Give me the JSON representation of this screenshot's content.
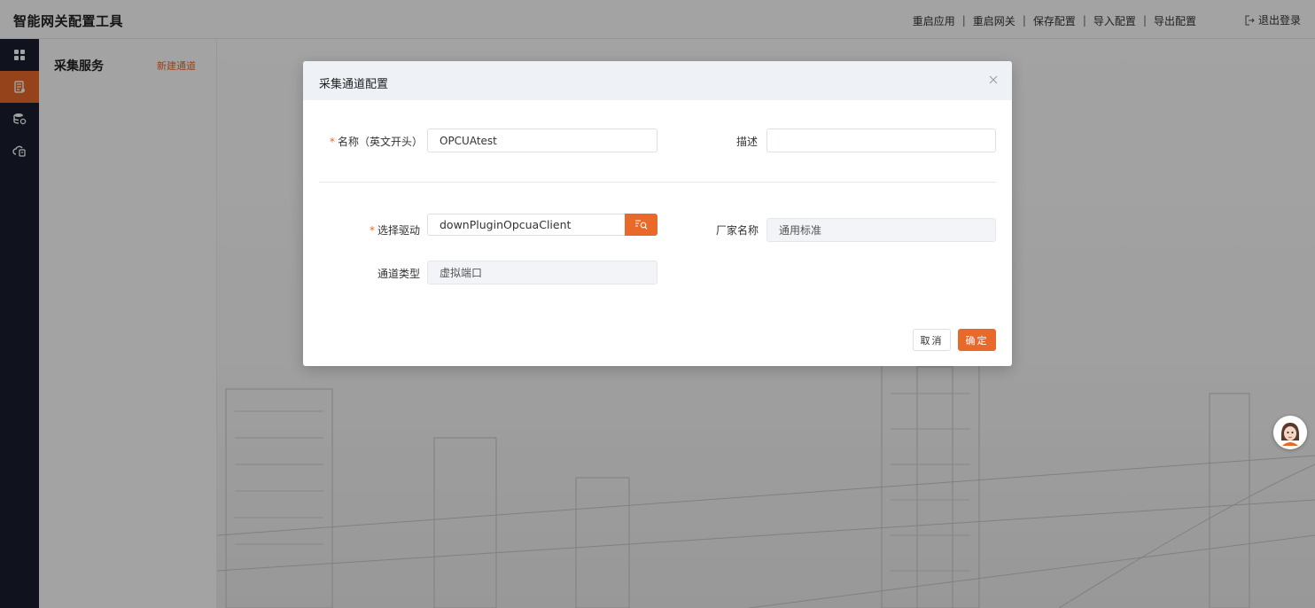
{
  "header": {
    "app_title": "智能网关配置工具",
    "nav": [
      {
        "label": "重启应用"
      },
      {
        "label": "重启网关"
      },
      {
        "label": "保存配置"
      },
      {
        "label": "导入配置"
      },
      {
        "label": "导出配置"
      }
    ],
    "separator": "|",
    "logout_label": "退出登录"
  },
  "rail": {
    "items": [
      {
        "icon": "dashboard-icon",
        "active": false
      },
      {
        "icon": "collect-service-icon",
        "active": true
      },
      {
        "icon": "database-icon",
        "active": false
      },
      {
        "icon": "cloud-upload-icon",
        "active": false
      }
    ],
    "accent": "#e8692a"
  },
  "subside": {
    "title": "采集服务",
    "new_channel_link": "新建通道"
  },
  "dialog": {
    "title": "采集通道配置",
    "name_label": "名称（英文开头）",
    "name_value": "OPCUAtest",
    "desc_label": "描述",
    "desc_value": "",
    "driver_label": "选择驱动",
    "driver_value": "downPluginOpcuaClient",
    "vendor_label": "厂家名称",
    "vendor_value": "通用标准",
    "channel_type_label": "通道类型",
    "channel_type_value": "虚拟端口",
    "required_mark": "*",
    "cancel_label": "取消",
    "ok_label": "确定"
  }
}
